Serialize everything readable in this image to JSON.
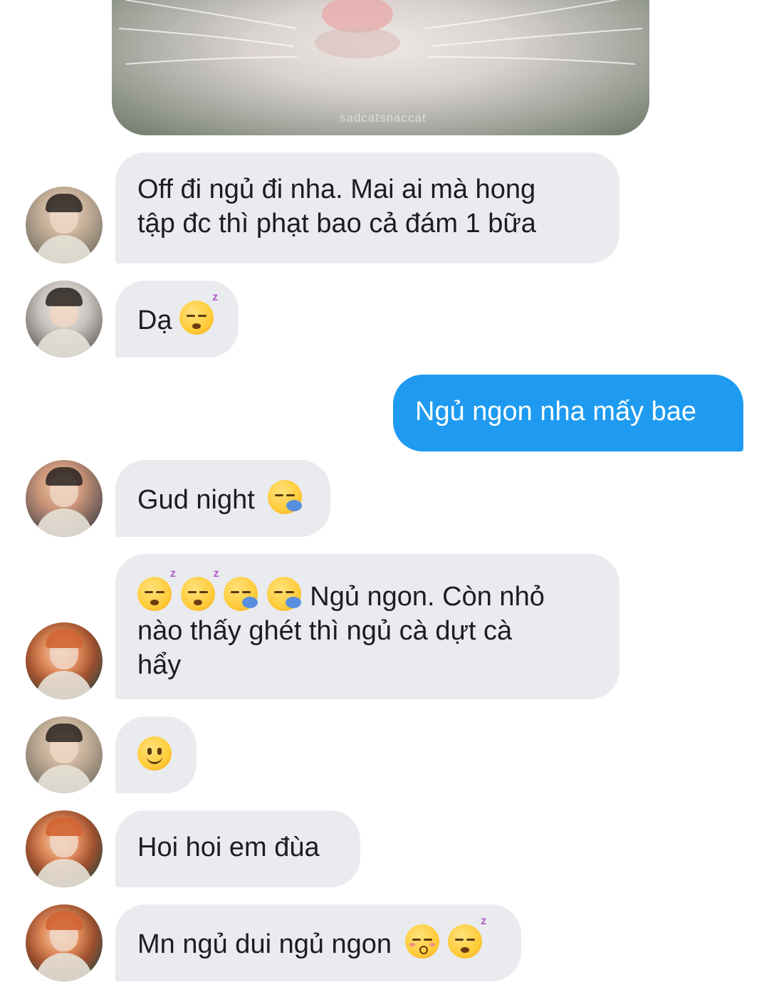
{
  "photo": {
    "watermark": "sadcatsnaccat"
  },
  "messages": [
    {
      "line1": "Off đi ngủ đi nha. Mai ai mà hong",
      "line2": "tập đc thì phạt bao cả đám 1 bữa"
    },
    {
      "text": "Dạ"
    },
    {
      "text": "Ngủ ngon nha mấy bae"
    },
    {
      "text": "Gud night"
    },
    {
      "line1": "Ngủ ngon. Còn nhỏ",
      "line2": "nào thấy ghét thì ngủ cà dựt cà",
      "line3": "hẩy"
    },
    {
      "text": ""
    },
    {
      "text": "Hoi hoi em đùa"
    },
    {
      "text": "Mn ngủ dui ngủ ngon"
    }
  ],
  "colors": {
    "incoming": "#e9ebef",
    "outgoing": "#1e9bf0"
  }
}
